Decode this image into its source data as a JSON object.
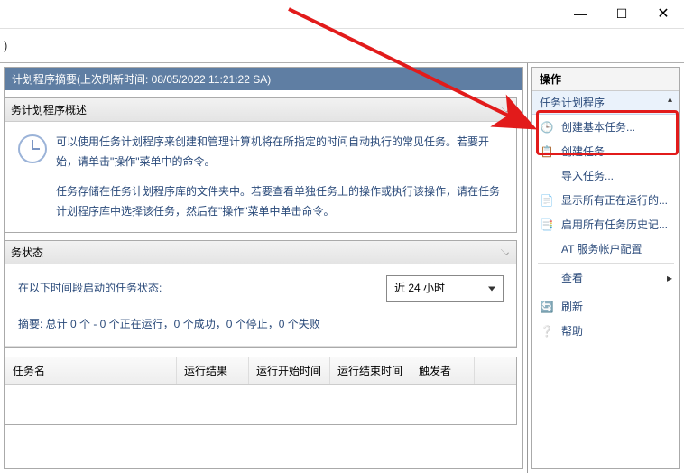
{
  "window": {
    "minimize": "—",
    "maximize": "☐",
    "close": "✕"
  },
  "summary_title": "计划程序摘要(上次刷新时间: 08/05/2022 11:21:22 SA)",
  "overview_panel": {
    "title": "务计划程序概述",
    "para1": "可以使用任务计划程序来创建和管理计算机将在所指定的时间自动执行的常见任务。若要开始，请单击\"操作\"菜单中的命令。",
    "para2": "任务存储在任务计划程序库的文件夹中。若要查看单独任务上的操作或执行该操作，请在任务计划程序库中选择该任务，然后在\"操作\"菜单中单击命令。"
  },
  "status_panel": {
    "title": "务状态",
    "label": "在以下时间段启动的任务状态:",
    "dropdown": "近 24 小时",
    "summary": "摘要: 总计 0 个 - 0 个正在运行，0 个成功，0 个停止，0 个失败"
  },
  "task_table": {
    "col_name": "任务名",
    "col_result": "运行结果",
    "col_start": "运行开始时间",
    "col_end": "运行结束时间",
    "col_trigger": "触发者"
  },
  "actions": {
    "title": "操作",
    "section": "任务计划程序",
    "items": [
      {
        "icon": "🕒",
        "label": "创建基本任务...",
        "name": "create-basic-task"
      },
      {
        "icon": "📋",
        "label": "创建任务...",
        "name": "create-task"
      },
      {
        "icon": "",
        "label": "导入任务...",
        "name": "import-task"
      },
      {
        "icon": "📄",
        "label": "显示所有正在运行的...",
        "name": "show-running"
      },
      {
        "icon": "📑",
        "label": "启用所有任务历史记...",
        "name": "enable-history"
      },
      {
        "icon": "",
        "label": "AT 服务帐户配置",
        "name": "at-service-account"
      },
      {
        "icon": "",
        "label": "查看",
        "name": "view",
        "chevron": true
      },
      {
        "icon": "🔄",
        "label": "刷新",
        "name": "refresh"
      },
      {
        "icon": "❔",
        "label": "帮助",
        "name": "help"
      }
    ]
  }
}
